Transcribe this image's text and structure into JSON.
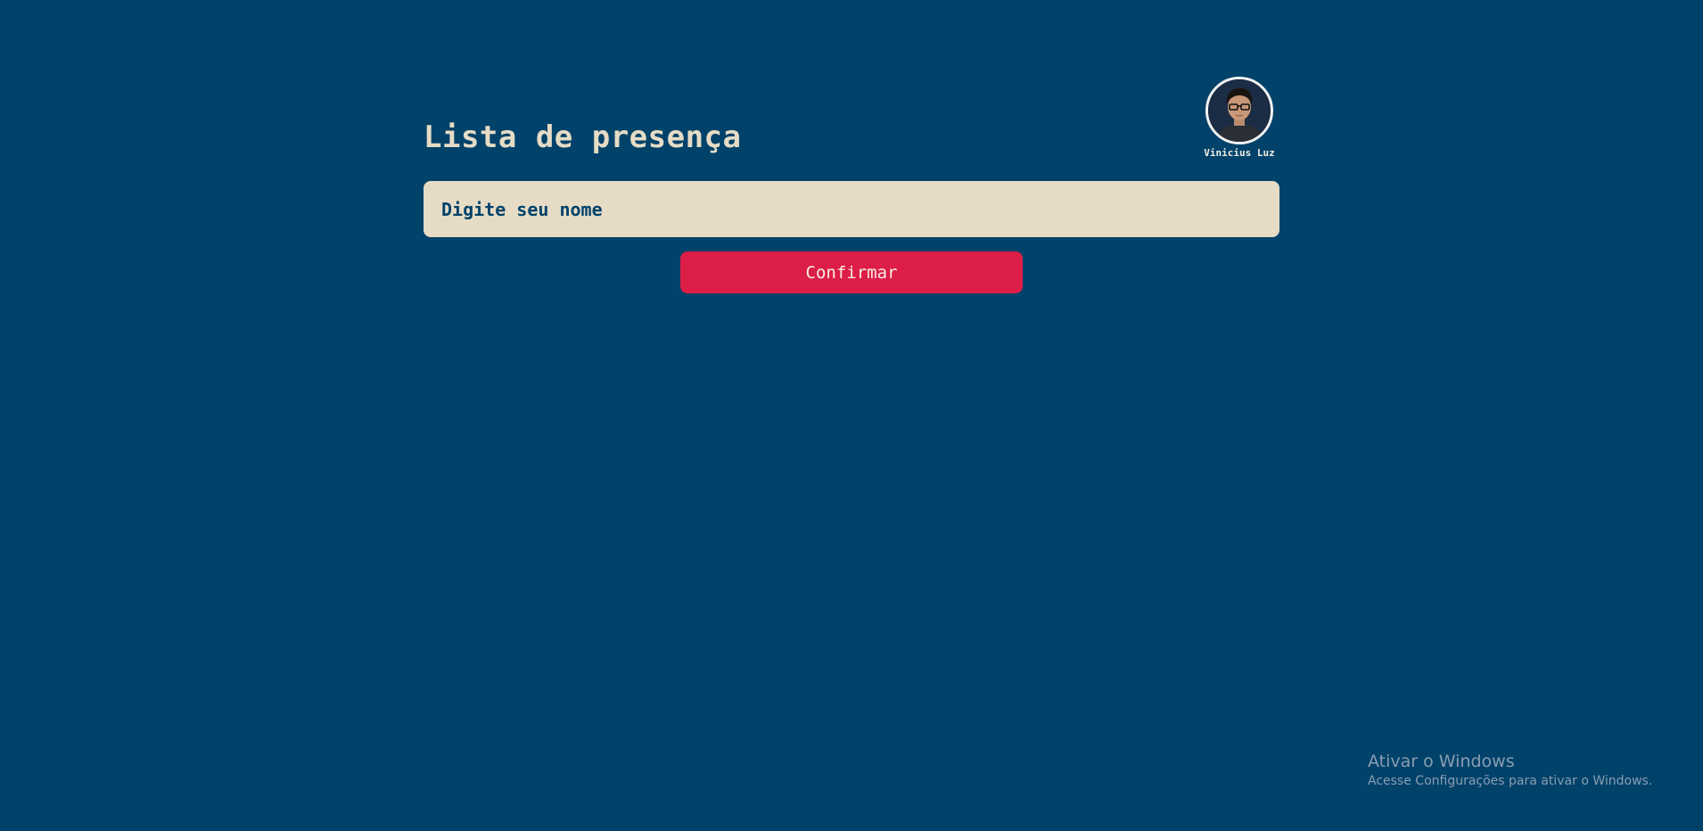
{
  "header": {
    "title": "Lista de presença"
  },
  "profile": {
    "name": "Vinicius Luz",
    "avatar_icon": "user-photo"
  },
  "form": {
    "input_placeholder": "Digite seu nome",
    "input_value": "",
    "confirm_label": "Confirmar"
  },
  "watermark": {
    "title": "Ativar o Windows",
    "subtitle": "Acesse Configurações para ativar o Windows."
  },
  "colors": {
    "background": "#00426A",
    "title": "#E6DCC6",
    "input_background": "#E6DCC6",
    "input_text": "#00426A",
    "button_background": "#DD1E48",
    "button_text": "#F6EFE6"
  }
}
